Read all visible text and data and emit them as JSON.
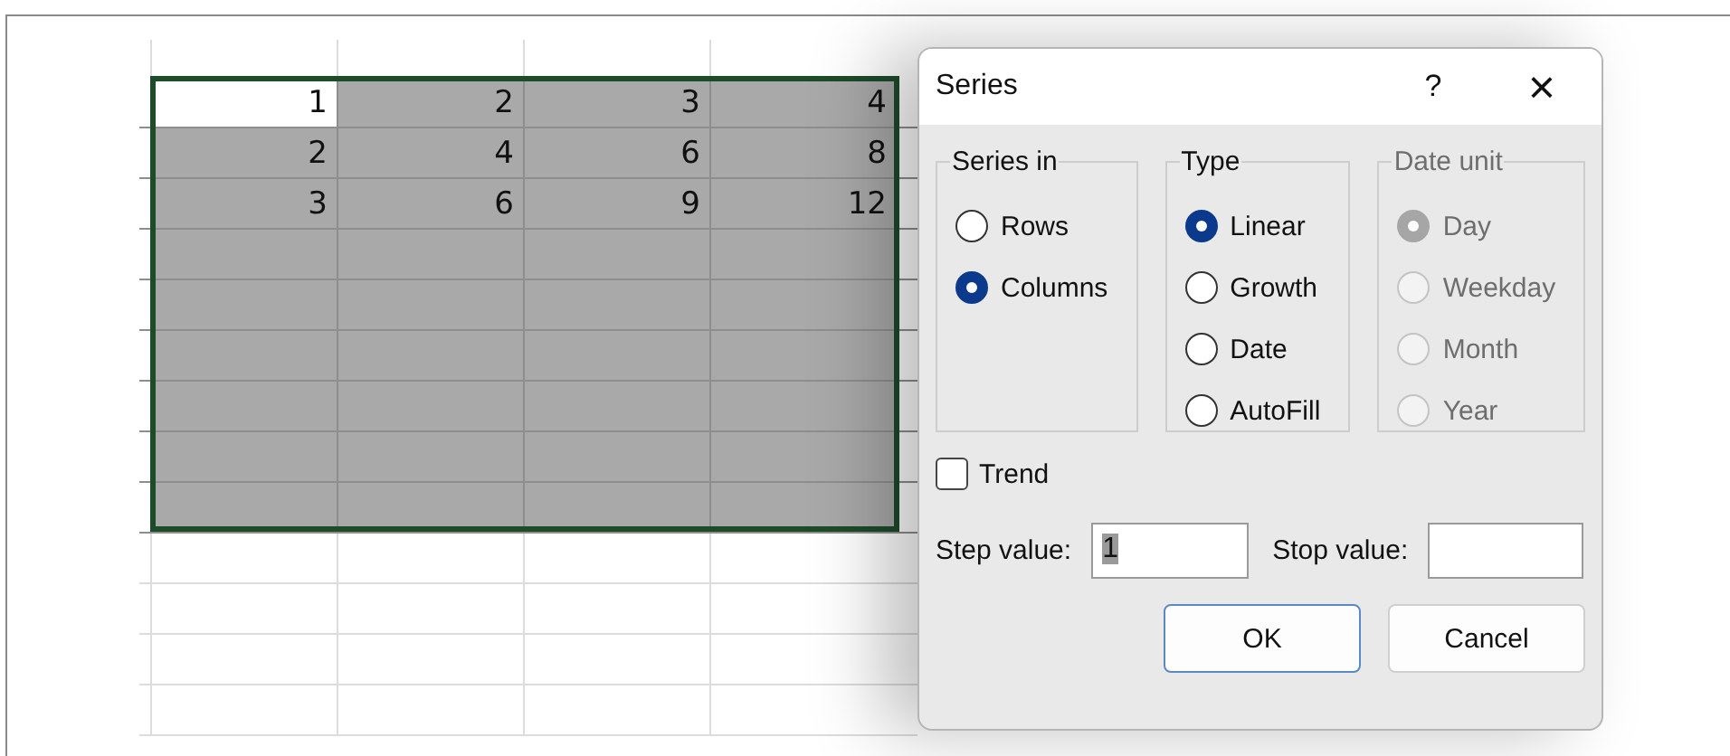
{
  "sheet": {
    "rows": [
      {
        "selected": true,
        "cells": [
          {
            "value": "1",
            "active": true
          },
          {
            "value": "2",
            "active": false
          },
          {
            "value": "3",
            "active": false
          },
          {
            "value": "4",
            "active": false
          }
        ]
      },
      {
        "selected": true,
        "cells": [
          {
            "value": "2",
            "active": false
          },
          {
            "value": "4",
            "active": false
          },
          {
            "value": "6",
            "active": false
          },
          {
            "value": "8",
            "active": false
          }
        ]
      },
      {
        "selected": true,
        "cells": [
          {
            "value": "3",
            "active": false
          },
          {
            "value": "6",
            "active": false
          },
          {
            "value": "9",
            "active": false
          },
          {
            "value": "12",
            "active": false
          }
        ]
      },
      {
        "selected": true
      },
      {
        "selected": true
      },
      {
        "selected": true
      },
      {
        "selected": true
      },
      {
        "selected": true
      },
      {
        "selected": true
      },
      {
        "selected": false
      },
      {
        "selected": false
      },
      {
        "selected": false
      },
      {
        "selected": false
      }
    ]
  },
  "dialog": {
    "title": "Series",
    "help": "?",
    "close": "×",
    "groups": [
      {
        "legend": "Series in",
        "disabled": false,
        "options": [
          {
            "label": "Rows",
            "selected": false
          },
          {
            "label": "Columns",
            "selected": true
          }
        ]
      },
      {
        "legend": "Type",
        "disabled": false,
        "options": [
          {
            "label": "Linear",
            "selected": true
          },
          {
            "label": "Growth",
            "selected": false
          },
          {
            "label": "Date",
            "selected": false
          },
          {
            "label": "AutoFill",
            "selected": false
          }
        ]
      },
      {
        "legend": "Date unit",
        "disabled": true,
        "options": [
          {
            "label": "Day",
            "selected": true
          },
          {
            "label": "Weekday",
            "selected": false
          },
          {
            "label": "Month",
            "selected": false
          },
          {
            "label": "Year",
            "selected": false
          }
        ]
      }
    ],
    "trend": {
      "label": "Trend",
      "checked": false
    },
    "step": {
      "label": "Step value:",
      "value": "1",
      "text_selected": true
    },
    "stop": {
      "label": "Stop value:"
    },
    "buttons": [
      {
        "label": "OK",
        "default": true
      },
      {
        "label": "Cancel",
        "default": false
      }
    ]
  }
}
